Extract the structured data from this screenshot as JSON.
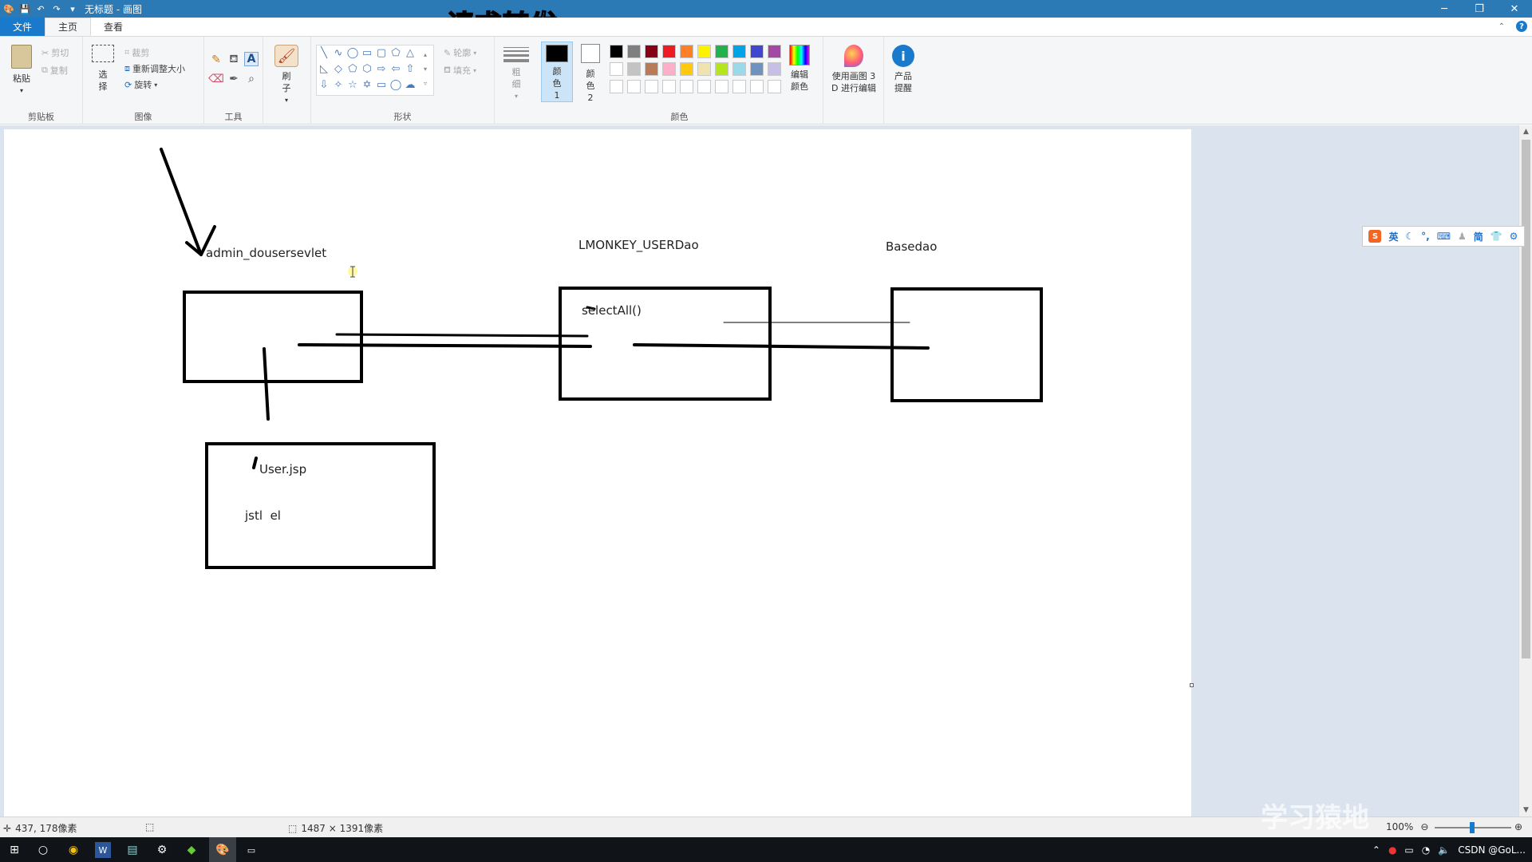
{
  "window": {
    "title": "无标题 - 画图",
    "overlay_caption": "请求转发",
    "controls": {
      "minimize": "─",
      "restore": "❐",
      "close": "✕"
    }
  },
  "menu": {
    "tabs": [
      "文件",
      "主页",
      "查看"
    ],
    "active_tab": "主页"
  },
  "ribbon": {
    "clipboard": {
      "label": "剪贴板",
      "paste": "粘贴",
      "cut": "剪切",
      "copy": "复制"
    },
    "image": {
      "label": "图像",
      "select": "选择",
      "crop": "裁剪",
      "resize": "重新调整大小",
      "rotate": "旋转"
    },
    "tools": {
      "label": "工具"
    },
    "brush": {
      "label": "刷子"
    },
    "shapes": {
      "label": "形状",
      "outline": "轮廓",
      "fill": "填充"
    },
    "size": {
      "label": "粗细"
    },
    "colors": {
      "label": "颜色",
      "color1": "颜色 1",
      "color2": "颜色 2",
      "edit": "编辑颜色",
      "row1": [
        "#000000",
        "#7f7f7f",
        "#880015",
        "#ed1c24",
        "#ff7f27",
        "#fff200",
        "#22b14c",
        "#00a2e8",
        "#3f48cc",
        "#a349a4"
      ],
      "row2": [
        "#ffffff",
        "#c3c3c3",
        "#b97a57",
        "#ffaec9",
        "#ffc90e",
        "#efe4b0",
        "#b5e61d",
        "#99d9ea",
        "#7092be",
        "#c8bfe7"
      ],
      "color1_value": "#000000",
      "color2_value": "#ffffff"
    },
    "paint3d": "使用画图 3 D 进行编辑",
    "product_alert": "产品提醒"
  },
  "canvas": {
    "labels": {
      "servlet": "admin_dousersevlet",
      "dao": "LMONKEY_USERDao",
      "basedao": "Basedao",
      "method": "selectAll()",
      "jsp": "User.jsp",
      "jstl": "jstl  el"
    }
  },
  "ime_toolbar": {
    "logo": "S",
    "lang": "英",
    "simp": "简"
  },
  "statusbar": {
    "cursor_pos": "437, 178像素",
    "canvas_size": "1487 × 1391像素",
    "zoom": "100%"
  },
  "watermarks": {
    "right": "学习猿地",
    "csdn": "CSDN @GoL..."
  }
}
